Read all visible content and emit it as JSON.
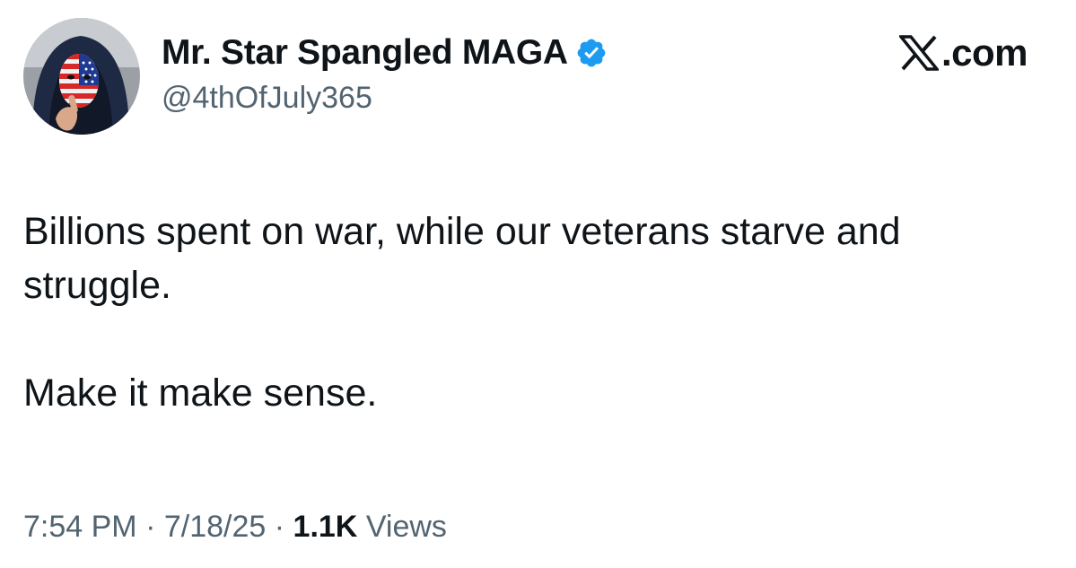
{
  "tweet": {
    "author": {
      "display_name": "Mr. Star Spangled MAGA",
      "handle": "@4thOfJuly365",
      "verified": true,
      "avatar_icon": "masked-person-avatar"
    },
    "brand": {
      "logo_letter": "X",
      "domain_suffix": ".com"
    },
    "text": {
      "paragraph_1": "Billions spent on war, while our veterans starve and\nstruggle.",
      "paragraph_2": "Make it make sense."
    },
    "meta": {
      "time": "7:54 PM",
      "separator": "·",
      "date": "7/18/25",
      "views_count": "1.1K",
      "views_label": "Views"
    }
  },
  "colors": {
    "text_primary": "#0f1419",
    "text_secondary": "#536471",
    "verified_badge": "#1d9bf0"
  }
}
